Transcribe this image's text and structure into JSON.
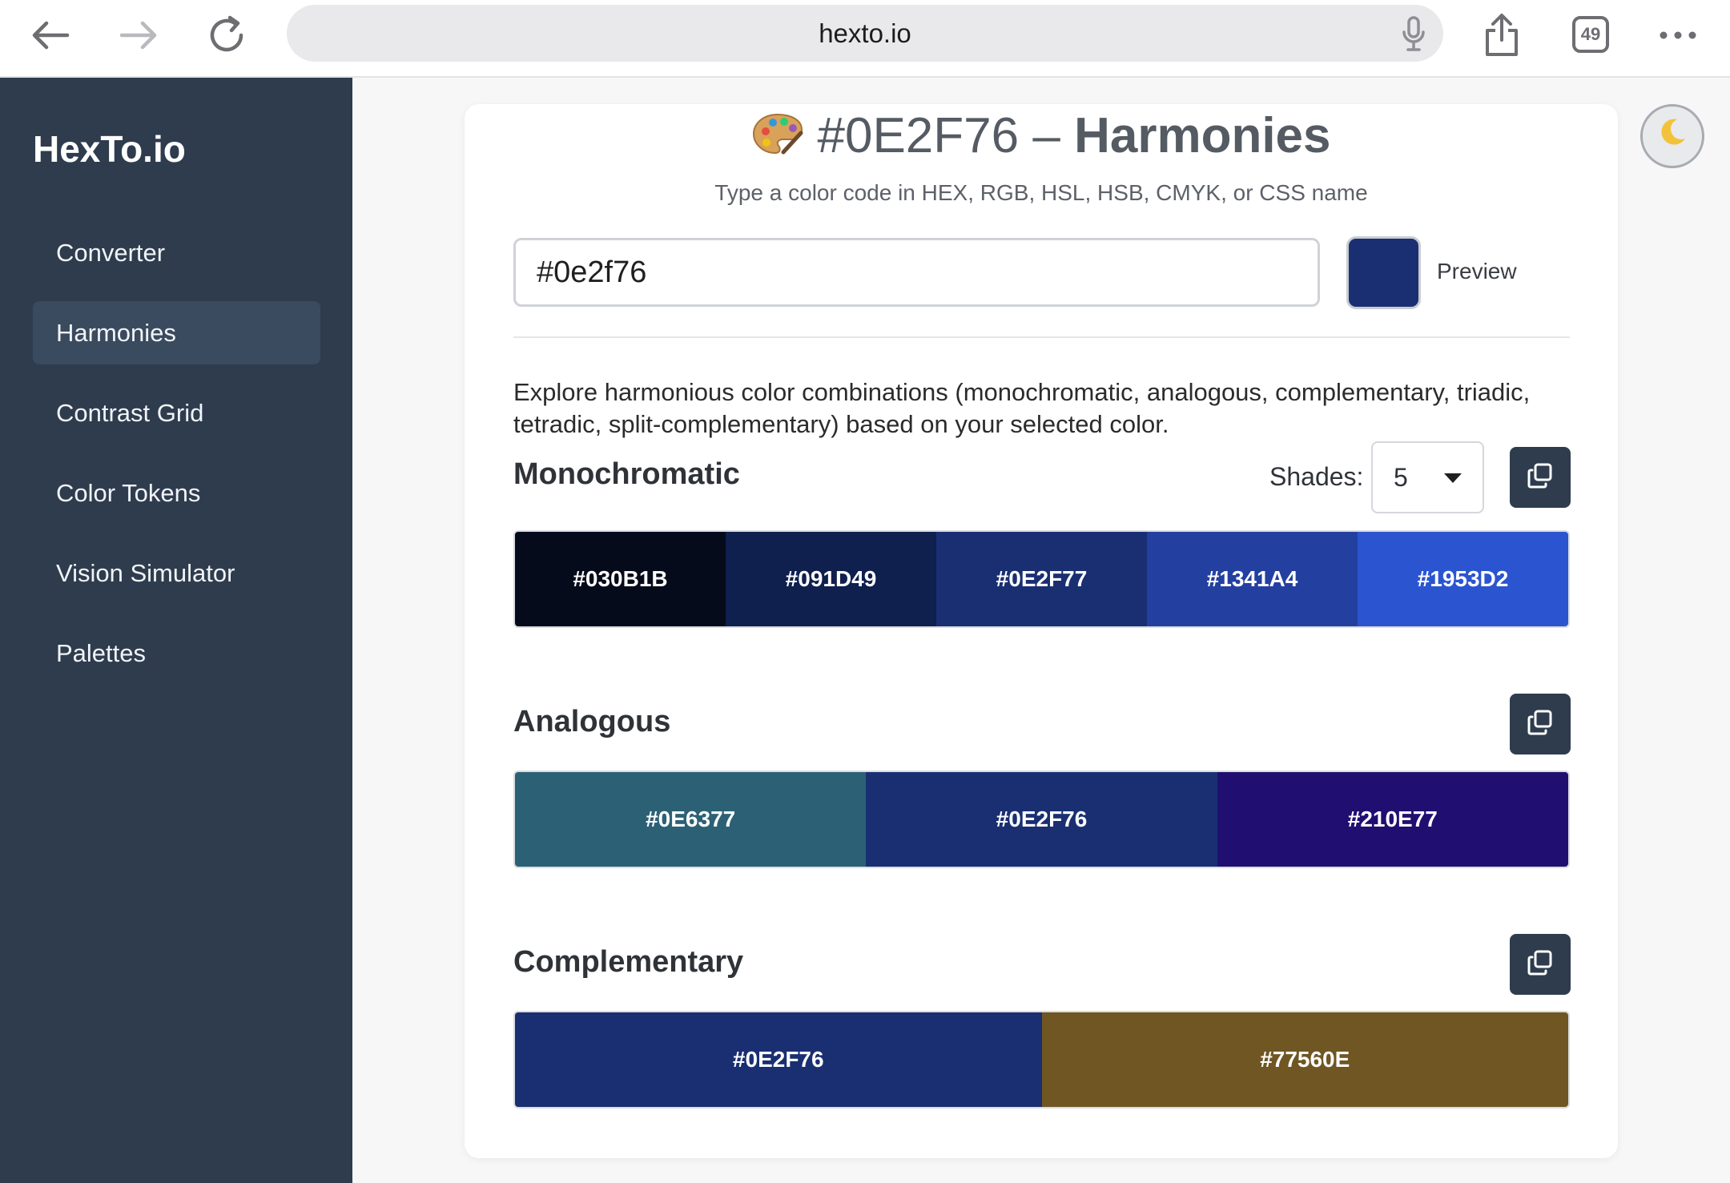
{
  "browser": {
    "url": "hexto.io",
    "tab_count": "49"
  },
  "sidebar": {
    "brand": "HexTo.io",
    "items": [
      {
        "label": "Converter"
      },
      {
        "label": "Harmonies"
      },
      {
        "label": "Contrast Grid"
      },
      {
        "label": "Color Tokens"
      },
      {
        "label": "Vision Simulator"
      },
      {
        "label": "Palettes"
      }
    ],
    "active_item": "Harmonies"
  },
  "main": {
    "title_code": "#0E2F76 –",
    "title_page": "Harmonies",
    "title_icon": "palette-icon",
    "subtitle": "Type a color code in HEX, RGB, HSL, HSB, CMYK, or CSS name",
    "input_value": "#0e2f76",
    "preview_color": "#1a2f72",
    "preview_label": "Preview",
    "description": "Explore harmonious color combinations (monochromatic, analogous, complementary, triadic, tetradic, split-complementary) based on your selected color.",
    "shades_label": "Shades:",
    "shades_value": "5"
  },
  "sections": {
    "monochromatic": {
      "title": "Monochromatic",
      "swatches": [
        {
          "label": "#030B1B",
          "color": "#060b1b"
        },
        {
          "label": "#091D49",
          "color": "#0f1f4e"
        },
        {
          "label": "#0E2F77",
          "color": "#1a2f72"
        },
        {
          "label": "#1341A4",
          "color": "#2340a0"
        },
        {
          "label": "#1953D2",
          "color": "#2b55d0"
        }
      ]
    },
    "analogous": {
      "title": "Analogous",
      "swatches": [
        {
          "label": "#0E6377",
          "color": "#2c6175"
        },
        {
          "label": "#0E2F76",
          "color": "#1a2f72"
        },
        {
          "label": "#210E77",
          "color": "#200f71"
        }
      ]
    },
    "complementary": {
      "title": "Complementary",
      "swatches": [
        {
          "label": "#0E2F76",
          "color": "#1a2f72"
        },
        {
          "label": "#77560E",
          "color": "#705623"
        }
      ]
    }
  },
  "colors": {
    "sidebar_bg": "#2e3c4e",
    "sidebar_active": "#3a4a5f",
    "copy_button": "#2e3c4e"
  },
  "theme_toggle_icon": "moon-icon"
}
